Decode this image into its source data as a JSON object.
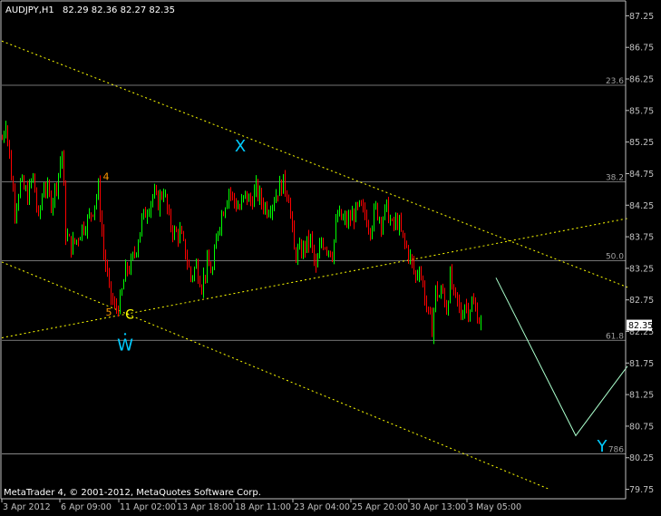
{
  "header": {
    "symbol": "AUDJPY,H1",
    "ohlc": "82.29 82.36 82.27 82.35"
  },
  "footer": {
    "copyright": "MetaTrader 4, © 2001-2012, MetaQuotes Software Corp."
  },
  "colors": {
    "background": "#000000",
    "axis": "#c0c0c0",
    "bull": "#00ff00",
    "bear": "#ff0000",
    "fib_line": "#c0c0c0",
    "trend_line": "#ffff00",
    "projection": "#aaffcc",
    "wave_label": "#00ccff",
    "price_tag": "#ffffff"
  },
  "chart_data": {
    "type": "candlestick",
    "instrument": "AUDJPY",
    "timeframe": "H1",
    "ylim": [
      79.6,
      87.5
    ],
    "y_ticks": [
      "87.25",
      "86.75",
      "86.25",
      "85.75",
      "85.25",
      "84.75",
      "84.25",
      "83.75",
      "83.25",
      "82.75",
      "82.25",
      "81.75",
      "81.25",
      "80.75",
      "80.25",
      "79.75"
    ],
    "x_ticks": [
      "3 Apr 2012",
      "6 Apr 09:00",
      "11 Apr 02:00",
      "13 Apr 18:00",
      "18 Apr 11:00",
      "23 Apr 04:00",
      "25 Apr 20:00",
      "30 Apr 13:00",
      "3 May 05:00"
    ],
    "current_price": "82.35",
    "close_path": [
      [
        0,
        85.3
      ],
      [
        4,
        85.6
      ],
      [
        8,
        85.0
      ],
      [
        14,
        84.2
      ],
      [
        20,
        84.6
      ],
      [
        28,
        84.4
      ],
      [
        34,
        84.7
      ],
      [
        40,
        84.0
      ],
      [
        46,
        84.6
      ],
      [
        54,
        84.3
      ],
      [
        60,
        84.6
      ],
      [
        66,
        85.1
      ],
      [
        70,
        83.8
      ],
      [
        76,
        83.6
      ],
      [
        82,
        83.7
      ],
      [
        88,
        83.9
      ],
      [
        94,
        84.0
      ],
      [
        100,
        84.2
      ],
      [
        106,
        84.5
      ],
      [
        112,
        83.5
      ],
      [
        118,
        82.9
      ],
      [
        124,
        82.6
      ],
      [
        130,
        82.7
      ],
      [
        136,
        83.2
      ],
      [
        142,
        83.3
      ],
      [
        148,
        83.6
      ],
      [
        154,
        84.0
      ],
      [
        160,
        84.2
      ],
      [
        166,
        84.4
      ],
      [
        172,
        84.3
      ],
      [
        178,
        84.5
      ],
      [
        184,
        84.0
      ],
      [
        190,
        83.8
      ],
      [
        196,
        83.8
      ],
      [
        202,
        83.5
      ],
      [
        208,
        83.1
      ],
      [
        214,
        83.3
      ],
      [
        220,
        83.0
      ],
      [
        226,
        83.3
      ],
      [
        232,
        83.2
      ],
      [
        238,
        83.9
      ],
      [
        244,
        84.2
      ],
      [
        250,
        84.5
      ],
      [
        256,
        84.3
      ],
      [
        262,
        84.2
      ],
      [
        268,
        84.4
      ],
      [
        274,
        84.3
      ],
      [
        280,
        84.5
      ],
      [
        286,
        84.3
      ],
      [
        292,
        84.2
      ],
      [
        298,
        84.3
      ],
      [
        304,
        84.5
      ],
      [
        310,
        84.6
      ],
      [
        316,
        84.4
      ],
      [
        322,
        83.5
      ],
      [
        328,
        83.5
      ],
      [
        334,
        83.6
      ],
      [
        340,
        83.7
      ],
      [
        346,
        83.2
      ],
      [
        352,
        83.7
      ],
      [
        358,
        83.6
      ],
      [
        364,
        83.5
      ],
      [
        370,
        84.1
      ],
      [
        376,
        84.0
      ],
      [
        382,
        84.0
      ],
      [
        388,
        84.1
      ],
      [
        394,
        84.2
      ],
      [
        400,
        84.1
      ],
      [
        406,
        83.9
      ],
      [
        412,
        84.2
      ],
      [
        418,
        84.0
      ],
      [
        424,
        84.2
      ],
      [
        430,
        83.9
      ],
      [
        436,
        84.0
      ],
      [
        442,
        83.7
      ],
      [
        448,
        83.5
      ],
      [
        452,
        83.3
      ],
      [
        456,
        83.1
      ],
      [
        460,
        83.3
      ],
      [
        466,
        82.8
      ],
      [
        470,
        82.5
      ],
      [
        474,
        82.3
      ],
      [
        478,
        82.9
      ],
      [
        482,
        82.8
      ],
      [
        486,
        82.9
      ],
      [
        490,
        82.6
      ],
      [
        494,
        83.1
      ],
      [
        498,
        82.8
      ],
      [
        502,
        82.7
      ],
      [
        506,
        82.5
      ],
      [
        510,
        82.7
      ],
      [
        514,
        82.6
      ],
      [
        518,
        82.7
      ],
      [
        522,
        82.6
      ],
      [
        526,
        82.45
      ],
      [
        529,
        82.35
      ]
    ],
    "fibonacci_levels": [
      {
        "label": "23.6",
        "value": 86.15
      },
      {
        "label": "38.2",
        "value": 84.62
      },
      {
        "label": "50.0",
        "value": 83.37
      },
      {
        "label": "61.8",
        "value": 82.11
      },
      {
        "label": "786",
        "value": 80.31
      }
    ],
    "trend_lines": [
      {
        "name": "upper-channel",
        "from": [
          0,
          86.85
        ],
        "to": [
          690,
          82.95
        ]
      },
      {
        "name": "lower-channel",
        "from": [
          0,
          83.35
        ],
        "to": [
          604,
          79.75
        ]
      },
      {
        "name": "support-trend",
        "from": [
          0,
          82.15
        ],
        "to": [
          690,
          84.04
        ]
      }
    ],
    "projection_path": [
      [
        545,
        83.1
      ],
      [
        633,
        80.6
      ],
      [
        690,
        81.7
      ]
    ],
    "wave_labels": [
      {
        "text": "X",
        "bar": 263,
        "price": 85.1
      },
      {
        "text": "W",
        "bar": 136,
        "price": 81.95
      },
      {
        "text": "C",
        "bar": 141,
        "price": 82.45
      },
      {
        "text": "Y",
        "bar": 662,
        "price": 80.35
      }
    ],
    "count_labels": [
      {
        "text": "4",
        "bar": 115,
        "price": 84.65
      },
      {
        "text": "5",
        "bar": 118,
        "price": 82.5
      }
    ]
  }
}
